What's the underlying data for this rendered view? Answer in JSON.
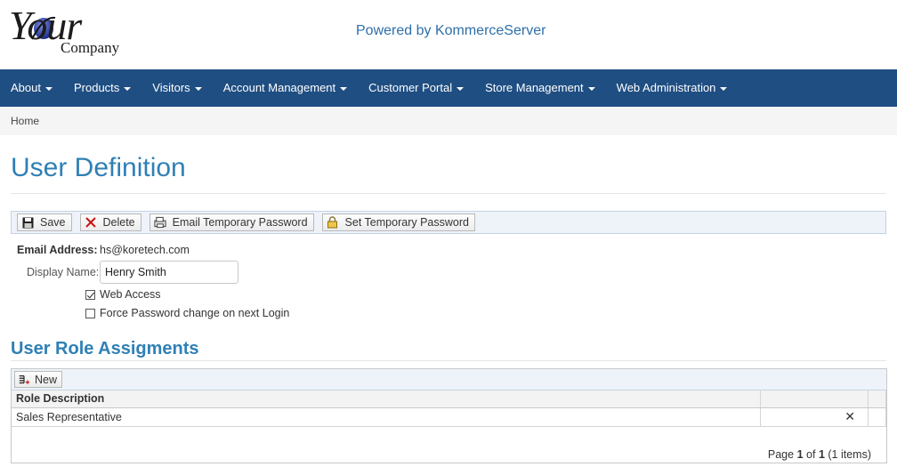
{
  "header": {
    "logo_text_main": "Your",
    "logo_text_sub": "Company",
    "powered_by": "Powered by KommerceServer"
  },
  "nav": {
    "items": [
      {
        "label": "About"
      },
      {
        "label": "Products"
      },
      {
        "label": "Visitors"
      },
      {
        "label": "Account Management"
      },
      {
        "label": "Customer Portal"
      },
      {
        "label": "Store Management"
      },
      {
        "label": "Web Administration"
      }
    ]
  },
  "breadcrumb": {
    "home": "Home"
  },
  "page": {
    "title": "User Definition"
  },
  "toolbar": {
    "save": "Save",
    "delete": "Delete",
    "email_temp": "Email Temporary Password",
    "set_temp": "Set Temporary Password"
  },
  "form": {
    "email_label": "Email Address:",
    "email_value": "hs@koretech.com",
    "display_label": "Display Name:",
    "display_value": "Henry Smith",
    "web_access_label": "Web Access",
    "web_access_checked": true,
    "force_pw_label": "Force Password change on next Login",
    "force_pw_checked": false
  },
  "roles": {
    "section_title": "User Role Assigments",
    "new_label": "New",
    "columns": [
      "Role Description",
      "",
      ""
    ],
    "rows": [
      {
        "role": "Sales Representative"
      }
    ],
    "pager": {
      "prefix": "Page",
      "page": "1",
      "of": "of",
      "total": "1",
      "items": "(1 items)"
    }
  },
  "colors": {
    "nav_bg": "#1f4e82",
    "title": "#2f80b5",
    "link": "#2f6fa8",
    "delete_x": "#dd1111"
  },
  "icons": [
    "save-icon",
    "delete-icon",
    "email-print-icon",
    "lock-icon",
    "new-row-icon",
    "remove-icon"
  ]
}
